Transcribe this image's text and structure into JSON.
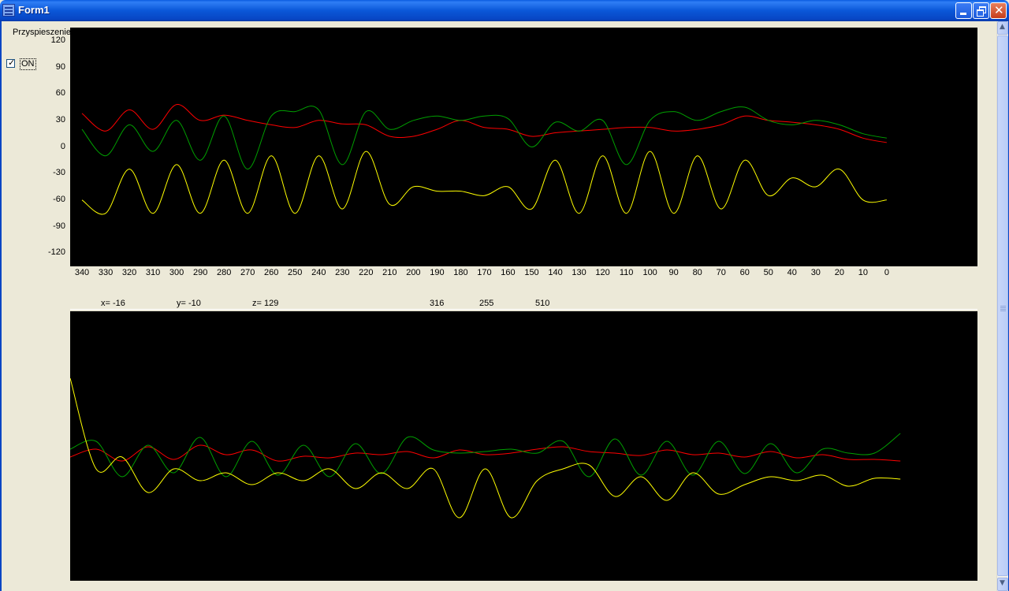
{
  "window": {
    "title": "Form1",
    "icon": "app-icon",
    "controls": [
      "minimize-icon",
      "maximize-icon",
      "close-icon"
    ]
  },
  "left_panel": {
    "ylabel": "Przyspieszenie",
    "yticks": [
      "120",
      "90",
      "60",
      "30",
      "0",
      "-30",
      "-60",
      "-90",
      "-120"
    ],
    "checkbox": {
      "label": "ON",
      "checked": true
    }
  },
  "readout": {
    "x": "x= -16",
    "y": "y= -10",
    "z": "z= 129",
    "v1": "316",
    "v2": "255",
    "v3": "510"
  },
  "colors": {
    "plot_background": "#000000",
    "series_red": "#ff0000",
    "series_green": "#00a000",
    "series_yellow": "#ffff00"
  },
  "chart_data": [
    {
      "type": "line",
      "title": "",
      "ylabel": "Przyspieszenie",
      "xlabel": "",
      "x_reversed": true,
      "xlim": [
        345,
        0
      ],
      "ylim": [
        -135,
        135
      ],
      "xticks": [
        340,
        330,
        320,
        310,
        300,
        290,
        280,
        270,
        260,
        250,
        240,
        230,
        220,
        210,
        200,
        190,
        180,
        170,
        160,
        150,
        140,
        130,
        120,
        110,
        100,
        90,
        80,
        70,
        60,
        50,
        40,
        30,
        20,
        10,
        0
      ],
      "yticks": [
        120,
        90,
        60,
        30,
        0,
        -30,
        -60,
        -90,
        -120
      ],
      "grid": false,
      "series": [
        {
          "color": "#ff0000",
          "x": [
            340,
            330,
            320,
            310,
            300,
            290,
            280,
            270,
            260,
            250,
            240,
            230,
            220,
            210,
            200,
            190,
            180,
            170,
            160,
            150,
            140,
            130,
            120,
            110,
            100,
            90,
            80,
            70,
            60,
            50,
            40,
            30,
            20,
            10,
            0
          ],
          "values": [
            38,
            18,
            42,
            20,
            48,
            30,
            36,
            30,
            25,
            22,
            30,
            26,
            25,
            12,
            12,
            20,
            30,
            22,
            20,
            12,
            16,
            18,
            20,
            22,
            22,
            18,
            20,
            25,
            35,
            30,
            28,
            25,
            20,
            10,
            5
          ]
        },
        {
          "color": "#00a000",
          "x": [
            340,
            330,
            320,
            310,
            300,
            290,
            280,
            270,
            260,
            250,
            240,
            230,
            220,
            210,
            200,
            190,
            180,
            170,
            160,
            150,
            140,
            130,
            120,
            110,
            100,
            90,
            80,
            70,
            60,
            50,
            40,
            30,
            20,
            10,
            0
          ],
          "values": [
            20,
            -10,
            25,
            -5,
            30,
            -15,
            35,
            -25,
            35,
            40,
            42,
            -20,
            40,
            20,
            30,
            35,
            30,
            35,
            32,
            0,
            28,
            18,
            30,
            -20,
            30,
            40,
            30,
            40,
            45,
            30,
            25,
            30,
            25,
            15,
            10
          ]
        },
        {
          "color": "#ffff00",
          "x": [
            340,
            330,
            320,
            310,
            300,
            290,
            280,
            270,
            260,
            250,
            240,
            230,
            220,
            210,
            200,
            190,
            180,
            170,
            160,
            150,
            140,
            130,
            120,
            110,
            100,
            90,
            80,
            70,
            60,
            50,
            40,
            30,
            20,
            10,
            0
          ],
          "values": [
            -60,
            -75,
            -25,
            -75,
            -20,
            -75,
            -15,
            -75,
            -10,
            -75,
            -10,
            -70,
            -5,
            -65,
            -45,
            -50,
            -50,
            -55,
            -45,
            -70,
            -15,
            -75,
            -10,
            -75,
            -5,
            -75,
            -10,
            -70,
            -15,
            -55,
            -35,
            -45,
            -25,
            -60,
            -60
          ]
        }
      ]
    },
    {
      "type": "line",
      "title": "",
      "xlabel": "",
      "ylabel": "",
      "grid": false,
      "series": [
        {
          "color": "#ff0000",
          "values": [
            185,
            175,
            190,
            172,
            188,
            170,
            182,
            176,
            190,
            184,
            186,
            180,
            182,
            178,
            186,
            176,
            182,
            180,
            175,
            172,
            178,
            180,
            183,
            176,
            182,
            180,
            185,
            178,
            186,
            182,
            188,
            188,
            190
          ]
        },
        {
          "color": "#00a000",
          "values": [
            175,
            165,
            210,
            170,
            205,
            160,
            210,
            165,
            208,
            170,
            210,
            168,
            206,
            160,
            176,
            180,
            178,
            175,
            180,
            165,
            210,
            162,
            208,
            165,
            208,
            165,
            206,
            168,
            205,
            175,
            180,
            180,
            155
          ]
        },
        {
          "color": "#ffff00",
          "values": [
            85,
            200,
            185,
            230,
            200,
            215,
            205,
            220,
            205,
            215,
            200,
            225,
            205,
            225,
            200,
            262,
            200,
            262,
            215,
            200,
            195,
            235,
            210,
            240,
            205,
            232,
            220,
            210,
            215,
            208,
            222,
            212,
            213
          ]
        }
      ]
    }
  ]
}
